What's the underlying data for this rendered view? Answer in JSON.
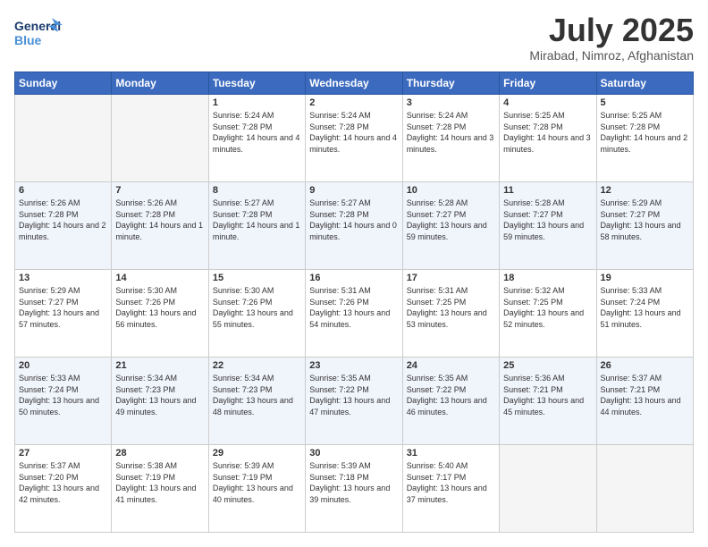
{
  "header": {
    "logo_general": "General",
    "logo_blue": "Blue",
    "title": "July 2025",
    "location": "Mirabad, Nimroz, Afghanistan"
  },
  "days_of_week": [
    "Sunday",
    "Monday",
    "Tuesday",
    "Wednesday",
    "Thursday",
    "Friday",
    "Saturday"
  ],
  "weeks": [
    {
      "days": [
        {
          "number": "",
          "empty": true
        },
        {
          "number": "",
          "empty": true
        },
        {
          "number": "1",
          "sunrise": "5:24 AM",
          "sunset": "7:28 PM",
          "daylight": "14 hours and 4 minutes."
        },
        {
          "number": "2",
          "sunrise": "5:24 AM",
          "sunset": "7:28 PM",
          "daylight": "14 hours and 4 minutes."
        },
        {
          "number": "3",
          "sunrise": "5:24 AM",
          "sunset": "7:28 PM",
          "daylight": "14 hours and 3 minutes."
        },
        {
          "number": "4",
          "sunrise": "5:25 AM",
          "sunset": "7:28 PM",
          "daylight": "14 hours and 3 minutes."
        },
        {
          "number": "5",
          "sunrise": "5:25 AM",
          "sunset": "7:28 PM",
          "daylight": "14 hours and 2 minutes."
        }
      ]
    },
    {
      "days": [
        {
          "number": "6",
          "sunrise": "5:26 AM",
          "sunset": "7:28 PM",
          "daylight": "14 hours and 2 minutes."
        },
        {
          "number": "7",
          "sunrise": "5:26 AM",
          "sunset": "7:28 PM",
          "daylight": "14 hours and 1 minute."
        },
        {
          "number": "8",
          "sunrise": "5:27 AM",
          "sunset": "7:28 PM",
          "daylight": "14 hours and 1 minute."
        },
        {
          "number": "9",
          "sunrise": "5:27 AM",
          "sunset": "7:28 PM",
          "daylight": "14 hours and 0 minutes."
        },
        {
          "number": "10",
          "sunrise": "5:28 AM",
          "sunset": "7:27 PM",
          "daylight": "13 hours and 59 minutes."
        },
        {
          "number": "11",
          "sunrise": "5:28 AM",
          "sunset": "7:27 PM",
          "daylight": "13 hours and 59 minutes."
        },
        {
          "number": "12",
          "sunrise": "5:29 AM",
          "sunset": "7:27 PM",
          "daylight": "13 hours and 58 minutes."
        }
      ]
    },
    {
      "days": [
        {
          "number": "13",
          "sunrise": "5:29 AM",
          "sunset": "7:27 PM",
          "daylight": "13 hours and 57 minutes."
        },
        {
          "number": "14",
          "sunrise": "5:30 AM",
          "sunset": "7:26 PM",
          "daylight": "13 hours and 56 minutes."
        },
        {
          "number": "15",
          "sunrise": "5:30 AM",
          "sunset": "7:26 PM",
          "daylight": "13 hours and 55 minutes."
        },
        {
          "number": "16",
          "sunrise": "5:31 AM",
          "sunset": "7:26 PM",
          "daylight": "13 hours and 54 minutes."
        },
        {
          "number": "17",
          "sunrise": "5:31 AM",
          "sunset": "7:25 PM",
          "daylight": "13 hours and 53 minutes."
        },
        {
          "number": "18",
          "sunrise": "5:32 AM",
          "sunset": "7:25 PM",
          "daylight": "13 hours and 52 minutes."
        },
        {
          "number": "19",
          "sunrise": "5:33 AM",
          "sunset": "7:24 PM",
          "daylight": "13 hours and 51 minutes."
        }
      ]
    },
    {
      "days": [
        {
          "number": "20",
          "sunrise": "5:33 AM",
          "sunset": "7:24 PM",
          "daylight": "13 hours and 50 minutes."
        },
        {
          "number": "21",
          "sunrise": "5:34 AM",
          "sunset": "7:23 PM",
          "daylight": "13 hours and 49 minutes."
        },
        {
          "number": "22",
          "sunrise": "5:34 AM",
          "sunset": "7:23 PM",
          "daylight": "13 hours and 48 minutes."
        },
        {
          "number": "23",
          "sunrise": "5:35 AM",
          "sunset": "7:22 PM",
          "daylight": "13 hours and 47 minutes."
        },
        {
          "number": "24",
          "sunrise": "5:35 AM",
          "sunset": "7:22 PM",
          "daylight": "13 hours and 46 minutes."
        },
        {
          "number": "25",
          "sunrise": "5:36 AM",
          "sunset": "7:21 PM",
          "daylight": "13 hours and 45 minutes."
        },
        {
          "number": "26",
          "sunrise": "5:37 AM",
          "sunset": "7:21 PM",
          "daylight": "13 hours and 44 minutes."
        }
      ]
    },
    {
      "days": [
        {
          "number": "27",
          "sunrise": "5:37 AM",
          "sunset": "7:20 PM",
          "daylight": "13 hours and 42 minutes."
        },
        {
          "number": "28",
          "sunrise": "5:38 AM",
          "sunset": "7:19 PM",
          "daylight": "13 hours and 41 minutes."
        },
        {
          "number": "29",
          "sunrise": "5:39 AM",
          "sunset": "7:19 PM",
          "daylight": "13 hours and 40 minutes."
        },
        {
          "number": "30",
          "sunrise": "5:39 AM",
          "sunset": "7:18 PM",
          "daylight": "13 hours and 39 minutes."
        },
        {
          "number": "31",
          "sunrise": "5:40 AM",
          "sunset": "7:17 PM",
          "daylight": "13 hours and 37 minutes."
        },
        {
          "number": "",
          "empty": true
        },
        {
          "number": "",
          "empty": true
        }
      ]
    }
  ]
}
